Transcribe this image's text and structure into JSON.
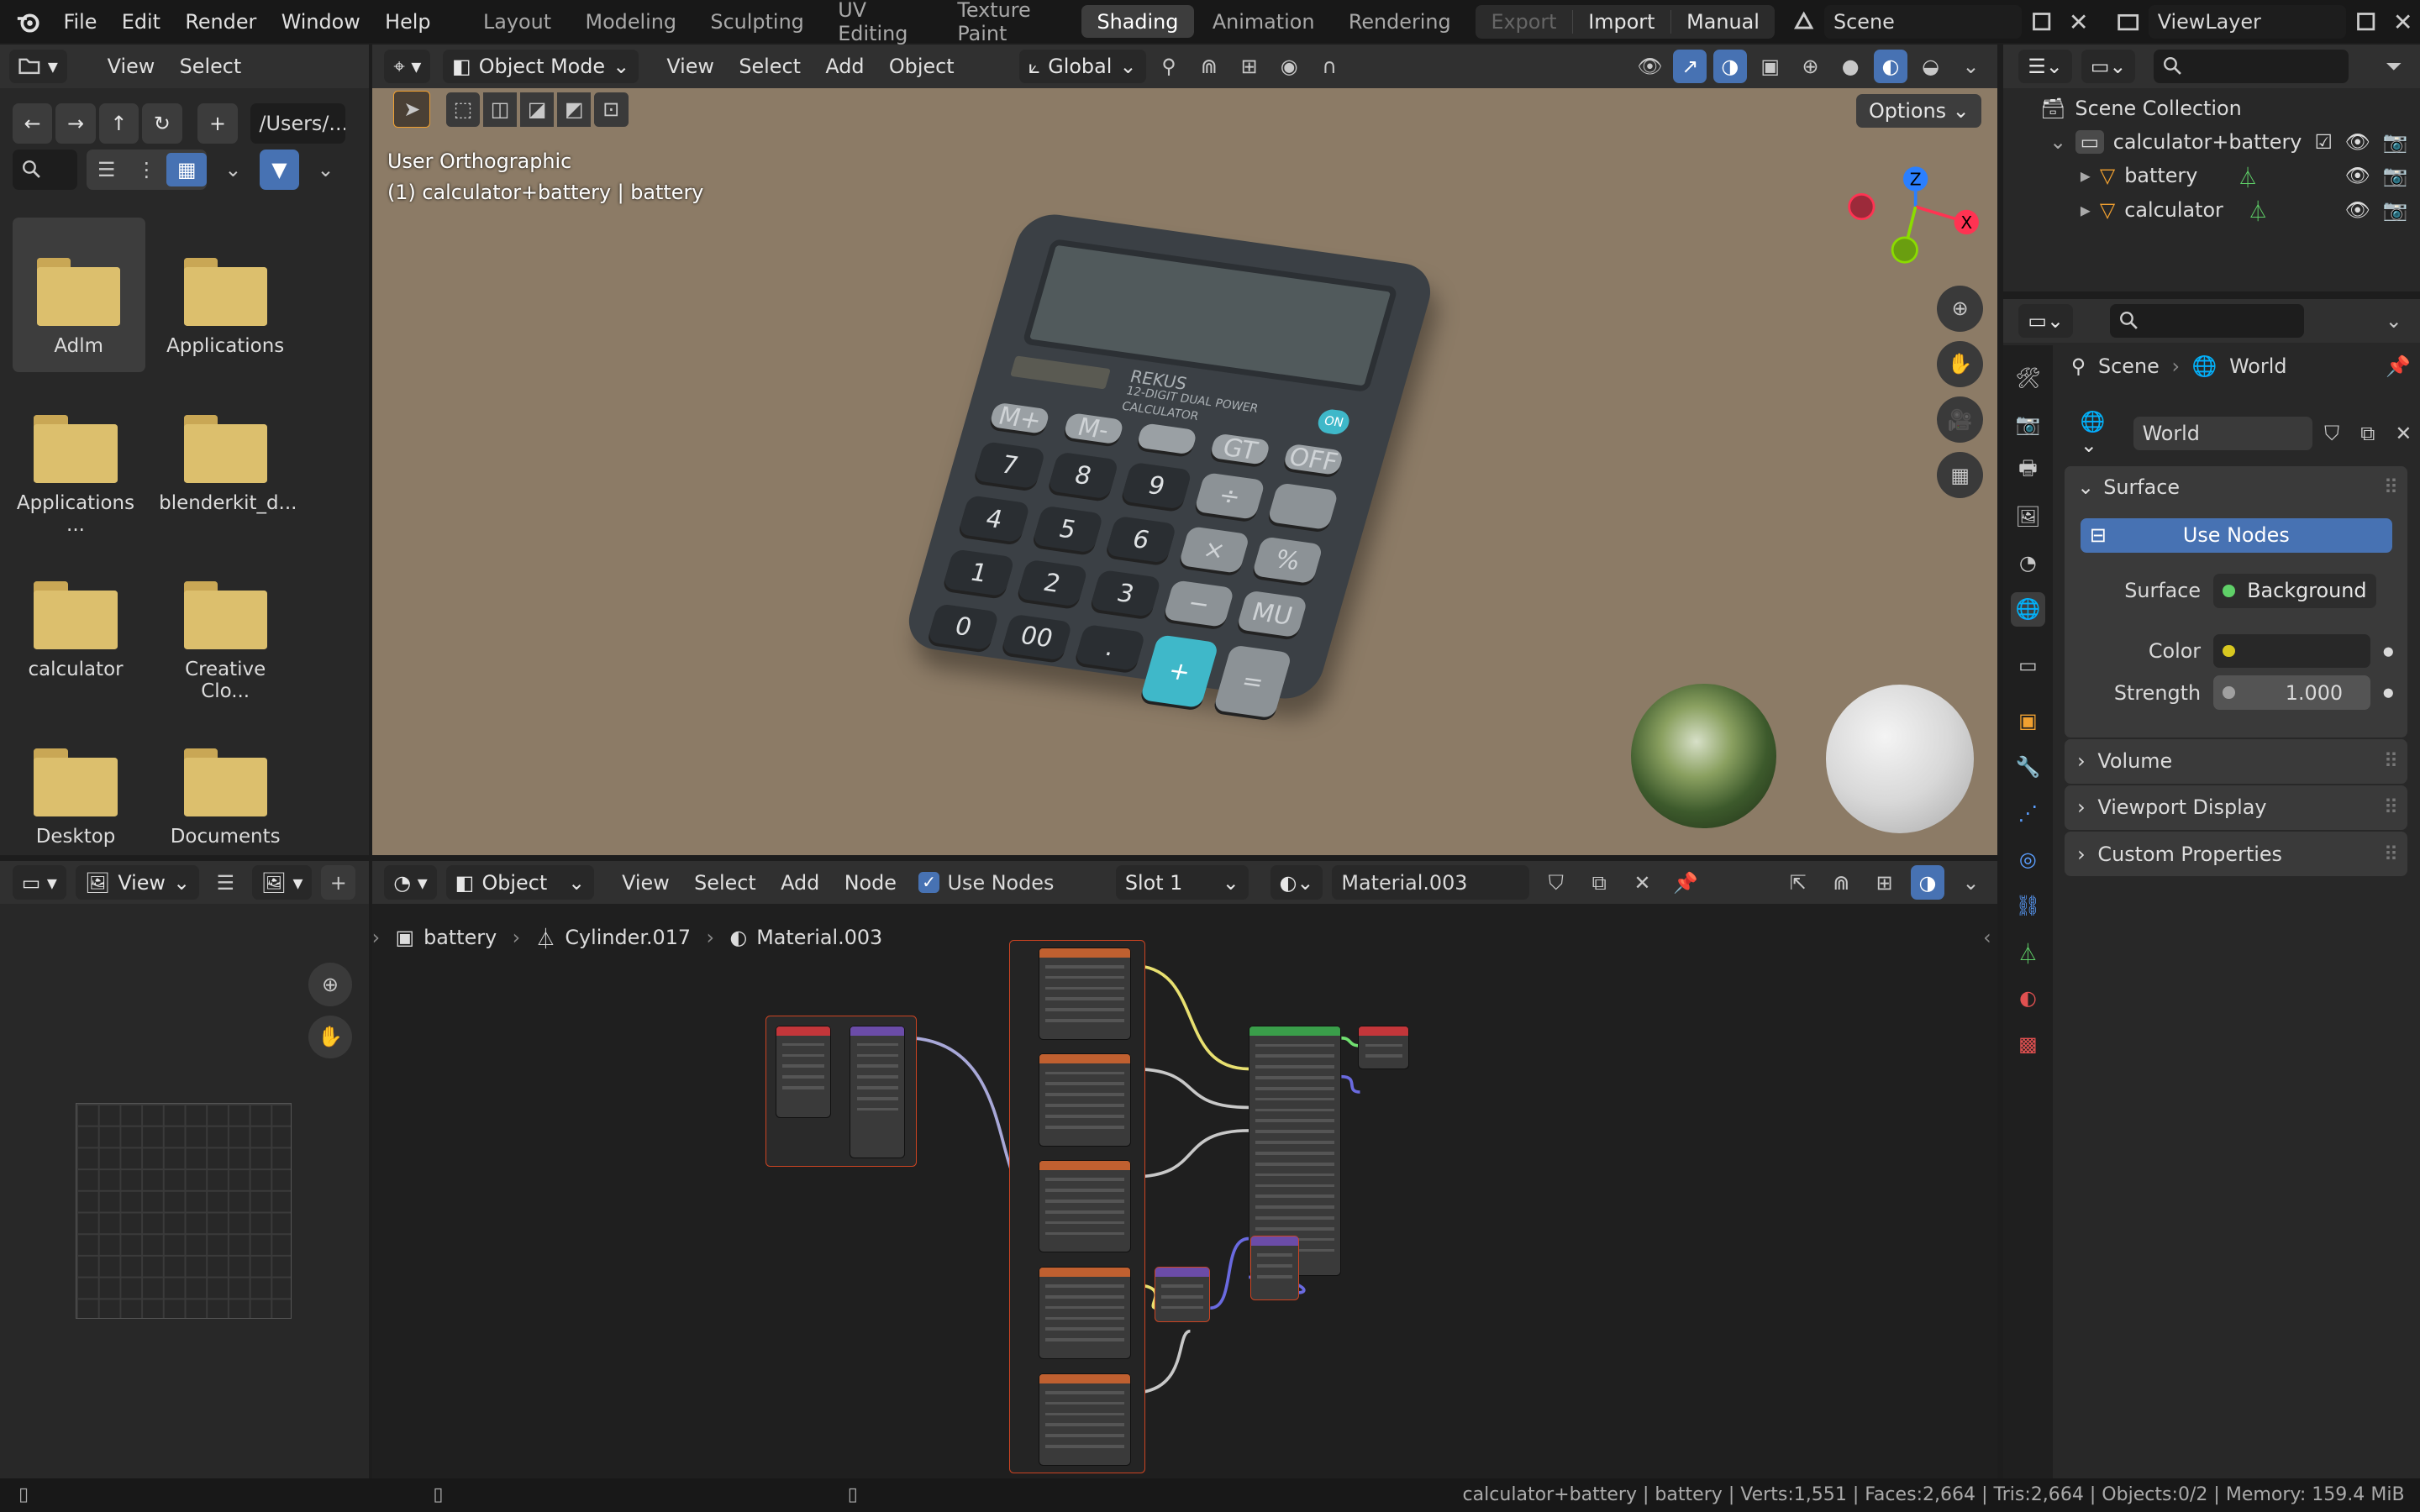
{
  "topbar": {
    "menus": [
      "File",
      "Edit",
      "Render",
      "Window",
      "Help"
    ],
    "workspaces": [
      "Layout",
      "Modeling",
      "Sculpting",
      "UV Editing",
      "Texture Paint",
      "Shading",
      "Animation",
      "Rendering"
    ],
    "active_workspace": "Shading",
    "export_label": "Export",
    "import_label": "Import",
    "manual_label": "Manual",
    "scene_name": "Scene",
    "view_layer": "ViewLayer"
  },
  "filebrowser": {
    "menus": [
      "View",
      "Select"
    ],
    "path": "/Users/...",
    "folders": [
      "Adlm",
      "Applications",
      "Applications ...",
      "blenderkit_d...",
      "calculator",
      "Creative Clo...",
      "Desktop",
      "Documents"
    ]
  },
  "viewport": {
    "mode": "Object Mode",
    "menus": [
      "View",
      "Select",
      "Add",
      "Object"
    ],
    "orientation": "Global",
    "options_label": "Options",
    "view_name": "User Orthographic",
    "object_info": "(1) calculator+battery | battery",
    "gizmo_axes": {
      "z": "Z",
      "x": "X"
    },
    "calculator": {
      "brand": "REKUS",
      "sub1": "12-DIGIT DUAL POWER",
      "sub2": "CALCULATOR",
      "on_label": "ON",
      "top_keys": [
        "M+",
        "M-",
        "",
        "GT",
        "OFF"
      ],
      "rows": [
        [
          "7",
          "8",
          "9",
          "÷",
          ""
        ],
        [
          "4",
          "5",
          "6",
          "×",
          "%"
        ],
        [
          "1",
          "2",
          "3",
          "−",
          "MU"
        ],
        [
          "0",
          "00",
          ".",
          "+",
          "="
        ]
      ]
    }
  },
  "nodeeditor": {
    "mode": "Object",
    "menus": [
      "View",
      "Select",
      "Add",
      "Node"
    ],
    "use_nodes_label": "Use Nodes",
    "slot": "Slot 1",
    "material": "Material.003",
    "breadcrumb": [
      "battery",
      "Cylinder.017",
      "Material.003"
    ],
    "image_view_label": "View"
  },
  "outliner": {
    "title": "Scene Collection",
    "items": [
      {
        "label": "calculator+battery",
        "level": 1
      },
      {
        "label": "battery",
        "level": 2
      },
      {
        "label": "calculator",
        "level": 2
      }
    ]
  },
  "properties": {
    "breadcrumb_scene": "Scene",
    "breadcrumb_world": "World",
    "world_name": "World",
    "surface_section": "Surface",
    "use_nodes_button": "Use Nodes",
    "surface_label": "Surface",
    "surface_value": "Background",
    "color_label": "Color",
    "strength_label": "Strength",
    "strength_value": "1.000",
    "sections": [
      "Volume",
      "Viewport Display",
      "Custom Properties"
    ]
  },
  "statusbar": {
    "text": "calculator+battery | battery | Verts:1,551 | Faces:2,664 | Tris:2,664 | Objects:0/2 | Memory: 159.4 MiB"
  },
  "colors": {
    "accent": "#4772b3",
    "folder": "#dcbf6d",
    "viewport_bg": "#8c7b66",
    "calculator_body": "#3b4045",
    "cyan_key": "#3fb8c9"
  }
}
